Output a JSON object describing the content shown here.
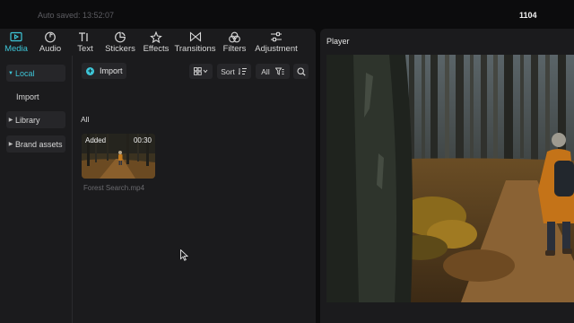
{
  "header": {
    "autosave": "Auto saved: 13:52:07",
    "project_name": "1104"
  },
  "toolbar": {
    "tabs": [
      {
        "label": "Media",
        "icon": "media-icon",
        "active": true
      },
      {
        "label": "Audio",
        "icon": "audio-icon"
      },
      {
        "label": "Text",
        "icon": "text-icon"
      },
      {
        "label": "Stickers",
        "icon": "stickers-icon"
      },
      {
        "label": "Effects",
        "icon": "effects-icon"
      },
      {
        "label": "Transitions",
        "icon": "transitions-icon"
      },
      {
        "label": "Filters",
        "icon": "filters-icon"
      },
      {
        "label": "Adjustment",
        "icon": "adjustment-icon"
      }
    ]
  },
  "sidebar": {
    "items": [
      {
        "label": "Local",
        "expanded": true,
        "active": true
      },
      {
        "label": "Import"
      },
      {
        "label": "Library",
        "expanded": false
      },
      {
        "label": "Brand assets",
        "expanded": false
      }
    ]
  },
  "media": {
    "import_label": "Import",
    "sort_label": "Sort",
    "filter_label": "All",
    "section_label": "All",
    "items": [
      {
        "badge": "Added",
        "duration": "00:30",
        "name": "Forest Search.mp4"
      }
    ]
  },
  "player": {
    "title": "Player"
  },
  "colors": {
    "accent": "#3ec6d8",
    "panel": "#1b1b1d",
    "background": "#0c0c0d"
  }
}
